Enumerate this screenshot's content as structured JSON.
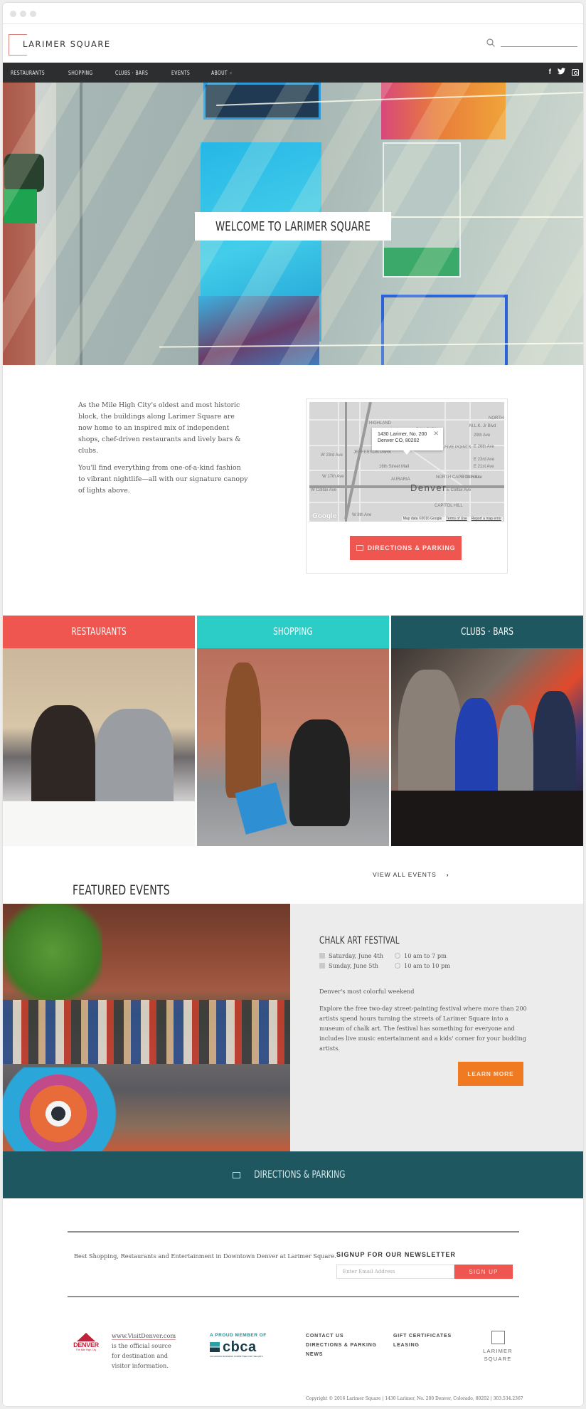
{
  "header": {
    "logo_text": "LARIMER SQUARE",
    "search": {
      "placeholder": "",
      "value": ""
    }
  },
  "nav": {
    "items": [
      {
        "label": "RESTAURANTS"
      },
      {
        "label": "SHOPPING"
      },
      {
        "label": "CLUBS · BARS"
      },
      {
        "label": "EVENTS"
      },
      {
        "label": "ABOUT",
        "has_dropdown": true
      }
    ],
    "social": [
      {
        "icon": "facebook-icon",
        "glyph": "f"
      },
      {
        "icon": "twitter-icon",
        "glyph": "t"
      },
      {
        "icon": "instagram-icon",
        "glyph": ""
      }
    ]
  },
  "hero": {
    "title": "WELCOME TO LARIMER SQUARE"
  },
  "intro": {
    "paragraphs": [
      "As the Mile High City's oldest and most historic block, the buildings along Larimer Square are now home to an inspired mix of independent shops, chef-driven restaurants and lively bars & clubs.",
      "You'll find everything from one-of-a-kind fashion to vibrant nightlife—all with our signature canopy of lights above."
    ]
  },
  "map": {
    "popup_line1": "1430 Larimer, No. 200",
    "popup_line2": "Denver CO, 80202",
    "city_label": "Denver",
    "labels": [
      "HIGHLAND",
      "BALLPARK",
      "JEFFERSON PARK",
      "FIVE POINTS",
      "AURARIA",
      "NORTH CAPITOL HILL",
      "CAPITOL HILL",
      "16th Street Mall",
      "W 23rd Ave",
      "W 17th Ave",
      "W Colfax Ave",
      "E Colfax Ave",
      "29th Ave",
      "E 26th Ave",
      "E 23rd Ave",
      "E 21st Ave",
      "E 18th Ave",
      "M.L.K. Jr Blvd",
      "NORTH",
      "W 8th Ave"
    ],
    "google_label": "Google",
    "footer_data": "Map data ©2016 Google",
    "terms": "Terms of Use",
    "report": "Report a map error",
    "button_label": "DIRECTIONS & PARKING",
    "colors": {
      "button": "#ef5650"
    }
  },
  "categories": [
    {
      "label": "RESTAURANTS",
      "color": "#ef5650"
    },
    {
      "label": "SHOPPING",
      "color": "#2bcdc6"
    },
    {
      "label": "CLUBS · BARS",
      "color": "#1f5760"
    }
  ],
  "events": {
    "section_title": "FEATURED EVENTS",
    "view_all": "VIEW ALL EVENTS",
    "featured": {
      "name": "CHALK ART FESTIVAL",
      "dates": [
        {
          "day": "Saturday, June 4th",
          "time": "10 am to 7 pm"
        },
        {
          "day": "Sunday, June 5th",
          "time": "10 am to 10 pm"
        }
      ],
      "tagline": "Denver's most colorful weekend",
      "description": "Explore the free two-day street-painting festival where more than 200 artists spend hours turning the streets of Larimer Square into a museum of chalk art. The festival has something for everyone and includes live music entertainment and a kids' corner for your budding artists.",
      "button_label": "LEARN MORE",
      "button_color": "#ef7a22"
    }
  },
  "directions_band": {
    "label": "DIRECTIONS & PARKING",
    "color": "#1f5760"
  },
  "footer": {
    "tagline": "Best Shopping, Restaurants and Entertainment in Downtown Denver at Larimer Square.",
    "newsletter": {
      "title": "SIGNUP FOR OUR NEWSLETTER",
      "placeholder": "Enter Email Address",
      "button_label": "SIGN UP"
    },
    "denver_logo": {
      "word": "DENVER",
      "sub": "The Mile High City"
    },
    "visit": {
      "link": "www.VisitDenver.com",
      "lines": [
        "is the official source",
        "for destination and",
        "visitor information."
      ]
    },
    "cbca": {
      "proud": "A PROUD MEMBER OF",
      "word": "cbca",
      "sub": "COLORADO BUSINESS COMMITTEE FOR THE ARTS"
    },
    "links_col1": [
      "CONTACT US",
      "DIRECTIONS & PARKING",
      "NEWS"
    ],
    "links_col2": [
      "GIFT CERTIFICATES",
      "LEASING"
    ],
    "logo_line1": "LARIMER",
    "logo_line2": "SQUARE",
    "copyright": "Copyright © 2016 Larimer Square  |  1430 Larimer, No. 200 Denver, Colorado, 80202  |  303.534.2367"
  }
}
